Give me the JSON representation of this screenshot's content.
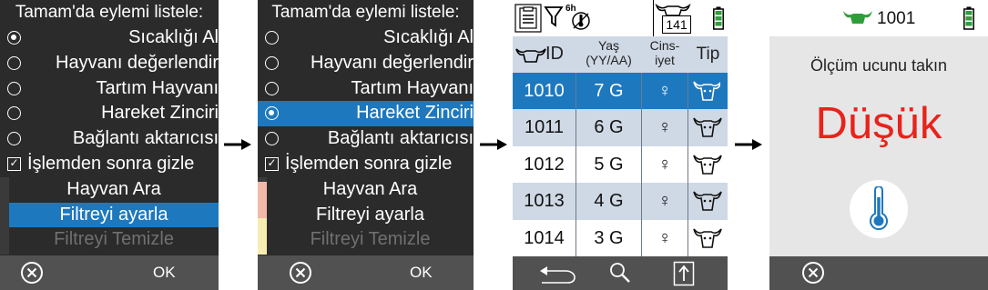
{
  "menu1": {
    "title": "Tamam'da eylemi listele:",
    "items": [
      {
        "label": "Sıcaklığı Al",
        "kind": "radio",
        "on": true
      },
      {
        "label": "Hayvanı değerlendir",
        "kind": "radio",
        "on": false
      },
      {
        "label": "Tartım Hayvanı",
        "kind": "radio",
        "on": false
      },
      {
        "label": "Hareket Zinciri",
        "kind": "radio",
        "on": false
      },
      {
        "label": "Bağlantı aktarıcısı",
        "kind": "radio",
        "on": false
      },
      {
        "label": "İşlemden sonra gizle",
        "kind": "check",
        "on": true
      },
      {
        "label": "Hayvan Ara",
        "kind": "plain"
      },
      {
        "label": "Filtreyi ayarla",
        "kind": "plain",
        "selected": true
      },
      {
        "label": "Filtreyi Temizle",
        "kind": "plain",
        "disabled": true
      }
    ],
    "softkeys": {
      "cancel_icon": "cancel-circle-icon",
      "ok": "OK"
    }
  },
  "menu2": {
    "title": "Tamam'da eylemi listele:",
    "items": [
      {
        "label": "Sıcaklığı Al",
        "kind": "radio",
        "on": false
      },
      {
        "label": "Hayvanı değerlendir",
        "kind": "radio",
        "on": false
      },
      {
        "label": "Tartım Hayvanı",
        "kind": "radio",
        "on": false
      },
      {
        "label": "Hareket Zinciri",
        "kind": "radio",
        "on": true,
        "selected": true
      },
      {
        "label": "Bağlantı aktarıcısı",
        "kind": "radio",
        "on": false
      },
      {
        "label": "İşlemden sonra gizle",
        "kind": "check",
        "on": true
      },
      {
        "label": "Hayvan Ara",
        "kind": "plain"
      },
      {
        "label": "Filtreyi ayarla",
        "kind": "plain"
      },
      {
        "label": "Filtreyi Temizle",
        "kind": "plain",
        "disabled": true
      }
    ],
    "softkeys": {
      "cancel_icon": "cancel-circle-icon",
      "ok": "OK"
    }
  },
  "table": {
    "status": {
      "icons": [
        "clipboard-list-icon",
        "filter-icon",
        "temperature-probe-icon",
        "cow-head-icon",
        "battery-icon"
      ],
      "filter_badge": "6h",
      "count": "141"
    },
    "headers": {
      "id": "ID",
      "age": "Yaş",
      "age_unit": "(YY/AA)",
      "sex_line1": "Cins-",
      "sex_line2": "iyet",
      "type": "Tip"
    },
    "rows": [
      {
        "id": "1010",
        "age": "7 G",
        "sex": "♀",
        "selected": true
      },
      {
        "id": "1011",
        "age": "6 G",
        "sex": "♀"
      },
      {
        "id": "1012",
        "age": "5 G",
        "sex": "♀"
      },
      {
        "id": "1013",
        "age": "4 G",
        "sex": "♀"
      },
      {
        "id": "1014",
        "age": "3 G",
        "sex": "♀"
      }
    ],
    "softkeys": [
      "back-arrow-icon",
      "search-icon",
      "upload-icon"
    ]
  },
  "measure": {
    "animal_id": "1001",
    "prompt": "Ölçüm ucunu takın",
    "value": "Düşük",
    "icons": [
      "cow-head-icon",
      "battery-icon",
      "thermometer-icon",
      "cancel-circle-icon"
    ]
  },
  "colors": {
    "accent": "#1e78be",
    "dark": "#2b2b2b",
    "softbar": "#515151",
    "alert": "#e8231b",
    "battery": "#2e9e3a"
  }
}
